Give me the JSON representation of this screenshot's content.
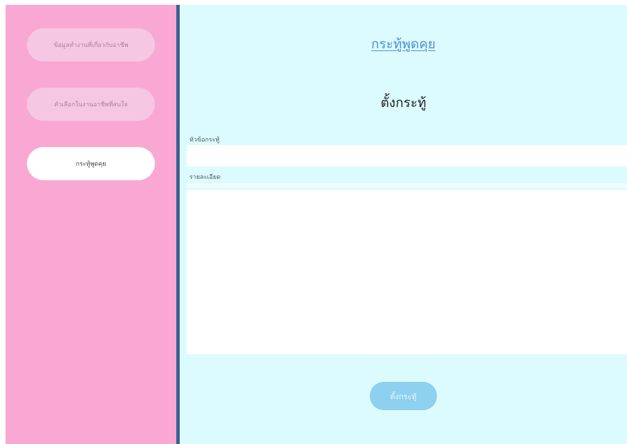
{
  "sidebar": {
    "items": [
      {
        "label": "ข้อมูลทำงานที่เกี่ยวกับอาชีพ"
      },
      {
        "label": "ตัวเลือกในงานอาชีพที่สนใจ"
      },
      {
        "label": "กระทู้พูดคุย"
      }
    ]
  },
  "main": {
    "title": "กระทู้พูดคุย",
    "heading": "ตั้งกระทู้",
    "topic_label": "หัวข้อกระทู้",
    "topic_value": "",
    "detail_label": "รายละเอียด",
    "detail_value": "",
    "submit_label": "ตั้งกระทู้"
  },
  "colors": {
    "sidebar_bg": "#f9a8d4",
    "divider": "#3b5f93",
    "main_bg": "#dcfbff",
    "title_link": "#4d8fd4",
    "submit_bg": "#8dd0ef"
  }
}
